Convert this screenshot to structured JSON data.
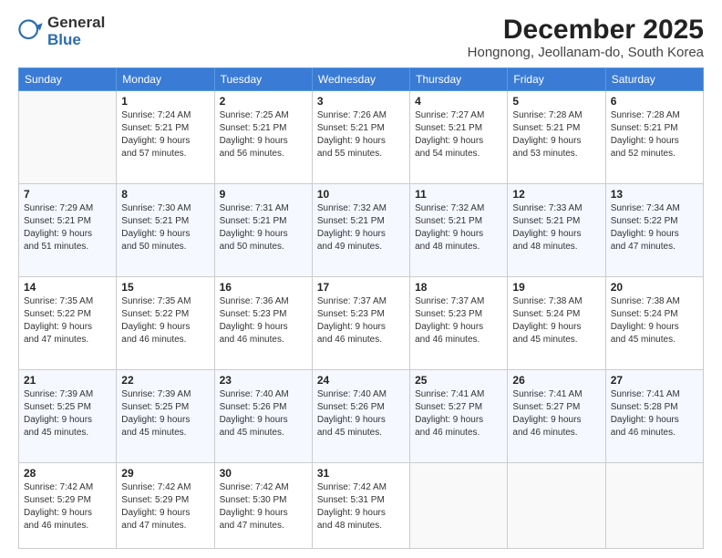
{
  "logo": {
    "general": "General",
    "blue": "Blue"
  },
  "title": "December 2025",
  "subtitle": "Hongnong, Jeollanam-do, South Korea",
  "days_of_week": [
    "Sunday",
    "Monday",
    "Tuesday",
    "Wednesday",
    "Thursday",
    "Friday",
    "Saturday"
  ],
  "weeks": [
    [
      {
        "day": "",
        "info": ""
      },
      {
        "day": "1",
        "info": "Sunrise: 7:24 AM\nSunset: 5:21 PM\nDaylight: 9 hours\nand 57 minutes."
      },
      {
        "day": "2",
        "info": "Sunrise: 7:25 AM\nSunset: 5:21 PM\nDaylight: 9 hours\nand 56 minutes."
      },
      {
        "day": "3",
        "info": "Sunrise: 7:26 AM\nSunset: 5:21 PM\nDaylight: 9 hours\nand 55 minutes."
      },
      {
        "day": "4",
        "info": "Sunrise: 7:27 AM\nSunset: 5:21 PM\nDaylight: 9 hours\nand 54 minutes."
      },
      {
        "day": "5",
        "info": "Sunrise: 7:28 AM\nSunset: 5:21 PM\nDaylight: 9 hours\nand 53 minutes."
      },
      {
        "day": "6",
        "info": "Sunrise: 7:28 AM\nSunset: 5:21 PM\nDaylight: 9 hours\nand 52 minutes."
      }
    ],
    [
      {
        "day": "7",
        "info": "Sunrise: 7:29 AM\nSunset: 5:21 PM\nDaylight: 9 hours\nand 51 minutes."
      },
      {
        "day": "8",
        "info": "Sunrise: 7:30 AM\nSunset: 5:21 PM\nDaylight: 9 hours\nand 50 minutes."
      },
      {
        "day": "9",
        "info": "Sunrise: 7:31 AM\nSunset: 5:21 PM\nDaylight: 9 hours\nand 50 minutes."
      },
      {
        "day": "10",
        "info": "Sunrise: 7:32 AM\nSunset: 5:21 PM\nDaylight: 9 hours\nand 49 minutes."
      },
      {
        "day": "11",
        "info": "Sunrise: 7:32 AM\nSunset: 5:21 PM\nDaylight: 9 hours\nand 48 minutes."
      },
      {
        "day": "12",
        "info": "Sunrise: 7:33 AM\nSunset: 5:21 PM\nDaylight: 9 hours\nand 48 minutes."
      },
      {
        "day": "13",
        "info": "Sunrise: 7:34 AM\nSunset: 5:22 PM\nDaylight: 9 hours\nand 47 minutes."
      }
    ],
    [
      {
        "day": "14",
        "info": "Sunrise: 7:35 AM\nSunset: 5:22 PM\nDaylight: 9 hours\nand 47 minutes."
      },
      {
        "day": "15",
        "info": "Sunrise: 7:35 AM\nSunset: 5:22 PM\nDaylight: 9 hours\nand 46 minutes."
      },
      {
        "day": "16",
        "info": "Sunrise: 7:36 AM\nSunset: 5:23 PM\nDaylight: 9 hours\nand 46 minutes."
      },
      {
        "day": "17",
        "info": "Sunrise: 7:37 AM\nSunset: 5:23 PM\nDaylight: 9 hours\nand 46 minutes."
      },
      {
        "day": "18",
        "info": "Sunrise: 7:37 AM\nSunset: 5:23 PM\nDaylight: 9 hours\nand 46 minutes."
      },
      {
        "day": "19",
        "info": "Sunrise: 7:38 AM\nSunset: 5:24 PM\nDaylight: 9 hours\nand 45 minutes."
      },
      {
        "day": "20",
        "info": "Sunrise: 7:38 AM\nSunset: 5:24 PM\nDaylight: 9 hours\nand 45 minutes."
      }
    ],
    [
      {
        "day": "21",
        "info": "Sunrise: 7:39 AM\nSunset: 5:25 PM\nDaylight: 9 hours\nand 45 minutes."
      },
      {
        "day": "22",
        "info": "Sunrise: 7:39 AM\nSunset: 5:25 PM\nDaylight: 9 hours\nand 45 minutes."
      },
      {
        "day": "23",
        "info": "Sunrise: 7:40 AM\nSunset: 5:26 PM\nDaylight: 9 hours\nand 45 minutes."
      },
      {
        "day": "24",
        "info": "Sunrise: 7:40 AM\nSunset: 5:26 PM\nDaylight: 9 hours\nand 45 minutes."
      },
      {
        "day": "25",
        "info": "Sunrise: 7:41 AM\nSunset: 5:27 PM\nDaylight: 9 hours\nand 46 minutes."
      },
      {
        "day": "26",
        "info": "Sunrise: 7:41 AM\nSunset: 5:27 PM\nDaylight: 9 hours\nand 46 minutes."
      },
      {
        "day": "27",
        "info": "Sunrise: 7:41 AM\nSunset: 5:28 PM\nDaylight: 9 hours\nand 46 minutes."
      }
    ],
    [
      {
        "day": "28",
        "info": "Sunrise: 7:42 AM\nSunset: 5:29 PM\nDaylight: 9 hours\nand 46 minutes."
      },
      {
        "day": "29",
        "info": "Sunrise: 7:42 AM\nSunset: 5:29 PM\nDaylight: 9 hours\nand 47 minutes."
      },
      {
        "day": "30",
        "info": "Sunrise: 7:42 AM\nSunset: 5:30 PM\nDaylight: 9 hours\nand 47 minutes."
      },
      {
        "day": "31",
        "info": "Sunrise: 7:42 AM\nSunset: 5:31 PM\nDaylight: 9 hours\nand 48 minutes."
      },
      {
        "day": "",
        "info": ""
      },
      {
        "day": "",
        "info": ""
      },
      {
        "day": "",
        "info": ""
      }
    ]
  ]
}
